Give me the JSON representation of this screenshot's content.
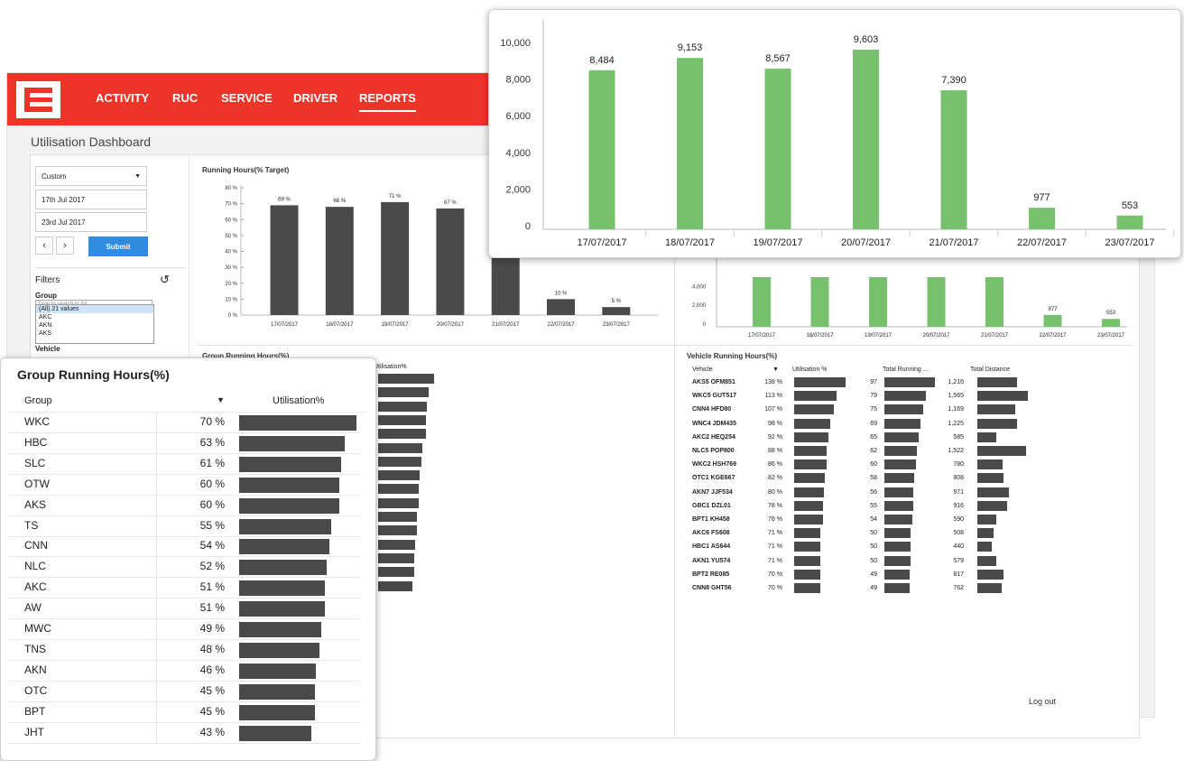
{
  "nav": {
    "items": [
      "ACTIVITY",
      "RUC",
      "SERVICE",
      "DRIVER",
      "REPORTS"
    ],
    "active": "REPORTS"
  },
  "page_title": "Utilisation Dashboard",
  "sidebar": {
    "period": "Custom",
    "date_from": "17th Jul 2017",
    "date_to": "23rd Jul 2017",
    "submit_label": "Submit",
    "filters_title": "Filters",
    "group_label": "Group",
    "search_placeholder": "Type to search in list",
    "group_options": [
      "(All) 21 values",
      "AKC",
      "AKN",
      "AKS"
    ],
    "vehicle_label": "Vehicle"
  },
  "running_hours": {
    "title": "Running Hours(% Target)",
    "yticks": [
      "80 %",
      "70 %",
      "60 %",
      "50 %",
      "40 %",
      "30 %",
      "20 %",
      "10 %",
      "0 %"
    ],
    "dates": [
      "17/07/2017",
      "18/07/2017",
      "19/07/2017",
      "20/07/2017",
      "21/07/2017",
      "22/07/2017",
      "23/07/2017"
    ],
    "labels": [
      "69 %",
      "68 %",
      "71 %",
      "67 %",
      "",
      "10 %",
      "5 %"
    ]
  },
  "distance_small": {
    "yticks": [
      "4,000",
      "2,000",
      "0"
    ],
    "labels": [
      "977",
      "553"
    ]
  },
  "group_running_small_title": "Group Running Hours(%)",
  "utilisation_header": "Utilisation%",
  "vehicle_running": {
    "title": "Vehicle Running Hours(%)",
    "columns": [
      "Vehicle",
      "Utilisation %",
      "Total Running ...",
      "Total Distance"
    ],
    "rows": [
      {
        "vehicle": "AKS5  OFM851",
        "util": "138 %",
        "running": "97",
        "distance": "1,216"
      },
      {
        "vehicle": "WKC5 GUT517",
        "util": "113 %",
        "running": "79",
        "distance": "1,565"
      },
      {
        "vehicle": "CNN4 HFD80",
        "util": "107 %",
        "running": "75",
        "distance": "1,169"
      },
      {
        "vehicle": "WNC4 JDM435",
        "util": "98 %",
        "running": "69",
        "distance": "1,225"
      },
      {
        "vehicle": "AKC2 HEQ254",
        "util": "92 %",
        "running": "65",
        "distance": "585"
      },
      {
        "vehicle": "NLC5 POP800",
        "util": "88 %",
        "running": "62",
        "distance": "1,522"
      },
      {
        "vehicle": "WKC2 HSH769",
        "util": "86 %",
        "running": "60",
        "distance": "780"
      },
      {
        "vehicle": "OTC1 KGE667",
        "util": "82 %",
        "running": "58",
        "distance": "808"
      },
      {
        "vehicle": "AKN7 JJF534",
        "util": "80 %",
        "running": "56",
        "distance": "971"
      },
      {
        "vehicle": "GBC1 DZL01",
        "util": "78 %",
        "running": "55",
        "distance": "916"
      },
      {
        "vehicle": "BPT1  KH458",
        "util": "78 %",
        "running": "54",
        "distance": "590"
      },
      {
        "vehicle": "AKC6 FS608",
        "util": "71 %",
        "running": "50",
        "distance": "508"
      },
      {
        "vehicle": "HBC1 AS644",
        "util": "71 %",
        "running": "50",
        "distance": "440"
      },
      {
        "vehicle": "AKN1  YU574",
        "util": "71 %",
        "running": "50",
        "distance": "579"
      },
      {
        "vehicle": "BPT2 RE085",
        "util": "70 %",
        "running": "49",
        "distance": "817"
      },
      {
        "vehicle": "CNN8 GHT56",
        "util": "70 %",
        "running": "49",
        "distance": "762"
      }
    ]
  },
  "logout": "Log out",
  "group_running": {
    "title": "Group Running Hours(%)",
    "col_group": "Group",
    "col_util": "Utilisation%",
    "rows": [
      {
        "group": "WKC",
        "util": "70 %"
      },
      {
        "group": "HBC",
        "util": "63 %"
      },
      {
        "group": "SLC",
        "util": "61 %"
      },
      {
        "group": "OTW",
        "util": "60 %"
      },
      {
        "group": "AKS",
        "util": "60 %"
      },
      {
        "group": "TS",
        "util": "55 %"
      },
      {
        "group": "CNN",
        "util": "54 %"
      },
      {
        "group": "NLC",
        "util": "52 %"
      },
      {
        "group": "AKC",
        "util": "51 %"
      },
      {
        "group": "AW",
        "util": "51 %"
      },
      {
        "group": "MWC",
        "util": "49 %"
      },
      {
        "group": "TNS",
        "util": "48 %"
      },
      {
        "group": "AKN",
        "util": "46 %"
      },
      {
        "group": "OTC",
        "util": "45 %"
      },
      {
        "group": "BPT",
        "util": "45 %"
      },
      {
        "group": "JHT",
        "util": "43 %"
      }
    ]
  },
  "colors": {
    "brand": "#ed3429",
    "bar_dark": "#4a4a4a",
    "bar_green": "#77c16e",
    "submit": "#2f8ce0"
  },
  "chart_data": [
    {
      "type": "bar",
      "categories": [
        "17/07/2017",
        "18/07/2017",
        "19/07/2017",
        "20/07/2017",
        "21/07/2017",
        "22/07/2017",
        "23/07/2017"
      ],
      "values": [
        8484,
        9153,
        8567,
        9603,
        7390,
        977,
        553
      ],
      "labels": [
        "8,484",
        "9,153",
        "8,567",
        "9,603",
        "7,390",
        "977",
        "553"
      ],
      "yticks": [
        "10,000",
        "8,000",
        "6,000",
        "4,000",
        "2,000",
        "0"
      ],
      "ylim": [
        0,
        10000
      ]
    },
    {
      "type": "bar",
      "title": "Running Hours(% Target)",
      "categories": [
        "17/07/2017",
        "18/07/2017",
        "19/07/2017",
        "20/07/2017",
        "21/07/2017",
        "22/07/2017",
        "23/07/2017"
      ],
      "values": [
        69,
        68,
        71,
        67,
        60,
        10,
        5
      ],
      "ylim": [
        0,
        80
      ]
    }
  ]
}
